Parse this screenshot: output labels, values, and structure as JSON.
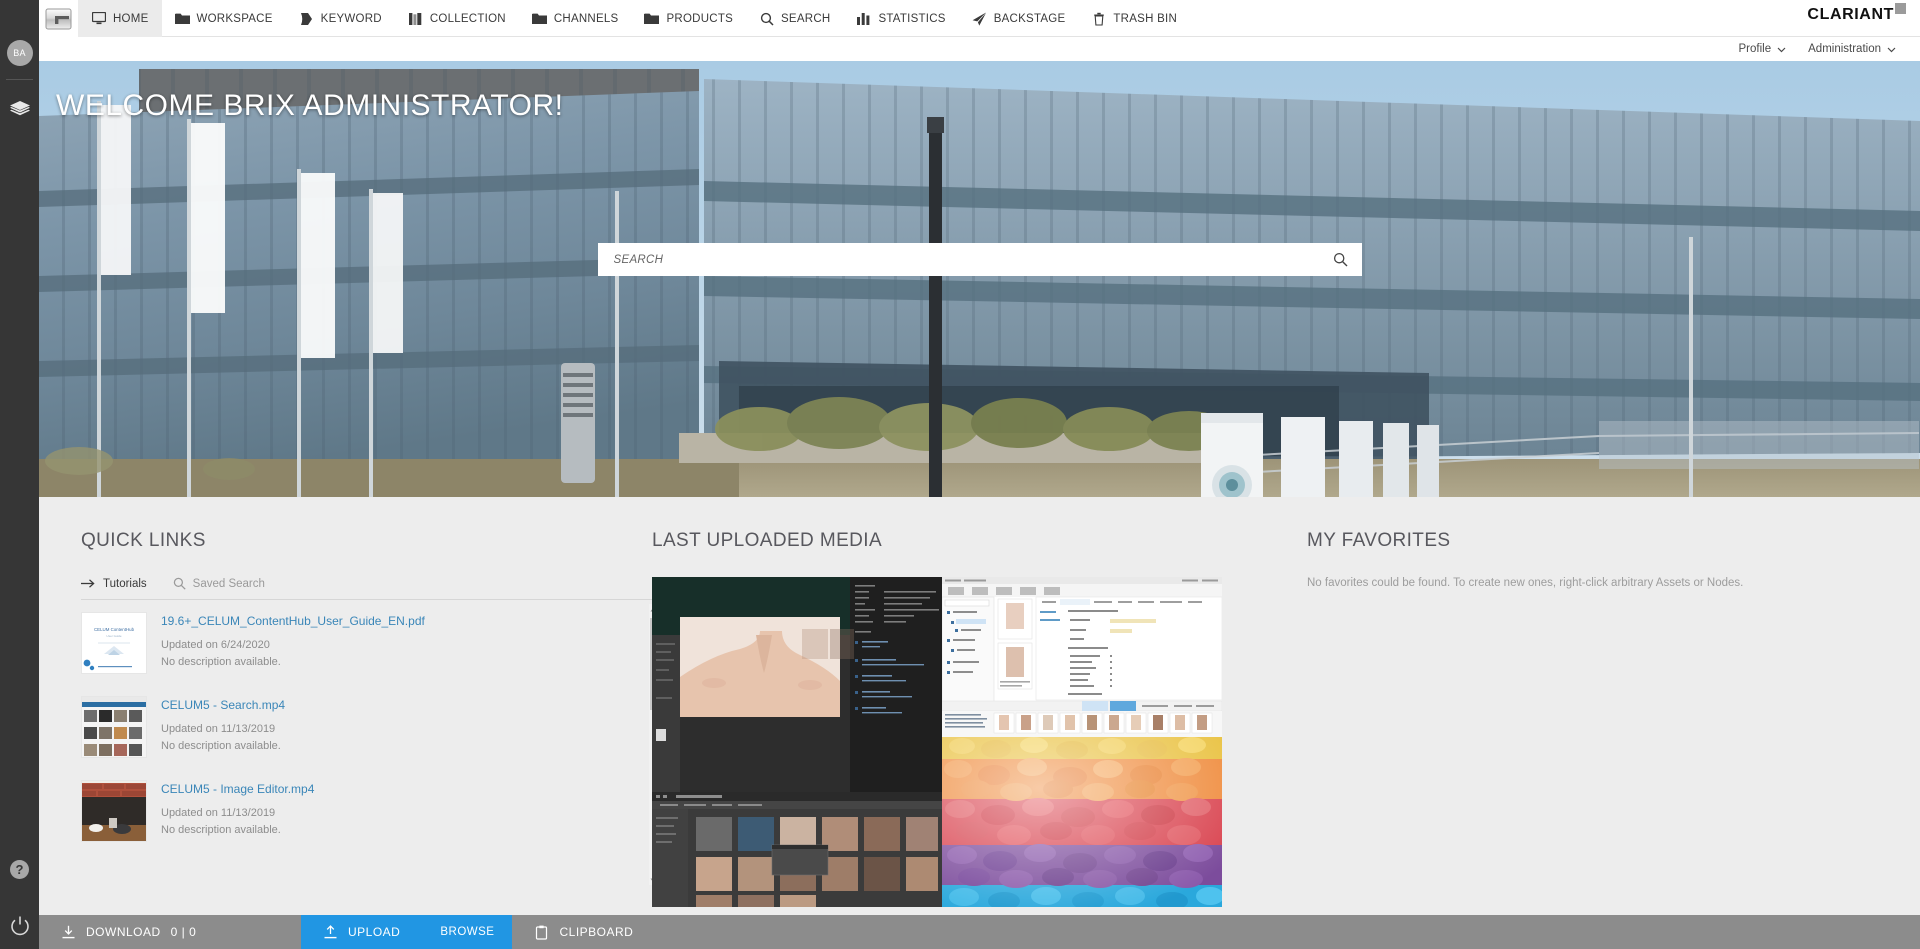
{
  "brand": {
    "logo_text": "CLARIANT"
  },
  "topnav": {
    "items": [
      {
        "label": "HOME",
        "icon": "monitor-icon",
        "active": true
      },
      {
        "label": "WORKSPACE",
        "icon": "folder-icon",
        "active": false
      },
      {
        "label": "KEYWORD",
        "icon": "tag-icon",
        "active": false
      },
      {
        "label": "COLLECTION",
        "icon": "books-icon",
        "active": false
      },
      {
        "label": "CHANNELS",
        "icon": "folder-icon",
        "active": false
      },
      {
        "label": "PRODUCTS",
        "icon": "folder-icon",
        "active": false
      },
      {
        "label": "SEARCH",
        "icon": "search-icon",
        "active": false
      },
      {
        "label": "STATISTICS",
        "icon": "bar-chart-icon",
        "active": false
      },
      {
        "label": "BACKSTAGE",
        "icon": "paper-plane-icon",
        "active": false
      },
      {
        "label": "TRASH BIN",
        "icon": "trash-icon",
        "active": false
      }
    ]
  },
  "subnav": {
    "items": [
      {
        "label": "Profile",
        "icon": "chevron-down-icon"
      },
      {
        "label": "Administration",
        "icon": "chevron-down-icon"
      }
    ]
  },
  "rail": {
    "avatar_initials": "BA",
    "layers_icon": "layers-icon",
    "help_icon": "question-mark-icon",
    "help_label": "?",
    "power_icon": "power-icon"
  },
  "hero": {
    "title": "WELCOME BRIX ADMINISTRATOR!",
    "search_placeholder": "SEARCH",
    "search_value": "",
    "search_icon": "search-icon"
  },
  "quick_links": {
    "title": "QUICK LINKS",
    "tabs": [
      {
        "label": "Tutorials",
        "icon": "arrow-right-icon",
        "active": true
      },
      {
        "label": "Saved Search",
        "icon": "search-icon",
        "active": false
      }
    ],
    "items": [
      {
        "name": "19.6+_CELUM_ContentHub_User_Guide_EN.pdf",
        "updated": "Updated on 6/24/2020",
        "description": "No description available.",
        "thumb": "pdf-cover"
      },
      {
        "name": "CELUM5 - Search.mp4",
        "updated": "Updated on 11/13/2019",
        "description": "No description available.",
        "thumb": "grid-screenshot"
      },
      {
        "name": "CELUM5 - Image Editor.mp4",
        "updated": "Updated on 11/13/2019",
        "description": "No description available.",
        "thumb": "desk-photo"
      }
    ]
  },
  "last_uploaded_media": {
    "title": "LAST UPLOADED MEDIA",
    "tiles": [
      {
        "name": "asset-preview-neck-photo",
        "kind": "app-screenshot-dark"
      },
      {
        "name": "asset-preview-pim-screenshot",
        "kind": "app-screenshot-light"
      },
      {
        "name": "asset-preview-colored-stones",
        "kind": "photo-colored-stones"
      },
      {
        "name": "asset-preview-editor-grid",
        "kind": "app-screenshot-grid"
      }
    ]
  },
  "favorites": {
    "title": "MY FAVORITES",
    "empty_message": "No favorites could be found. To create new ones, right-click arbitrary Assets or Nodes."
  },
  "bottombar": {
    "download_label": "DOWNLOAD",
    "download_count": "0 | 0",
    "download_icon": "download-icon",
    "upload_label": "UPLOAD",
    "upload_icon": "upload-icon",
    "browse_label": "BROWSE",
    "clipboard_label": "CLIPBOARD",
    "clipboard_icon": "clipboard-icon"
  },
  "colors": {
    "accent_blue": "#2196e3",
    "link_blue": "#3a86b8",
    "rail_dark": "#363636",
    "panel_bg": "#ededed",
    "bottom_gray": "#8c8c8c"
  }
}
